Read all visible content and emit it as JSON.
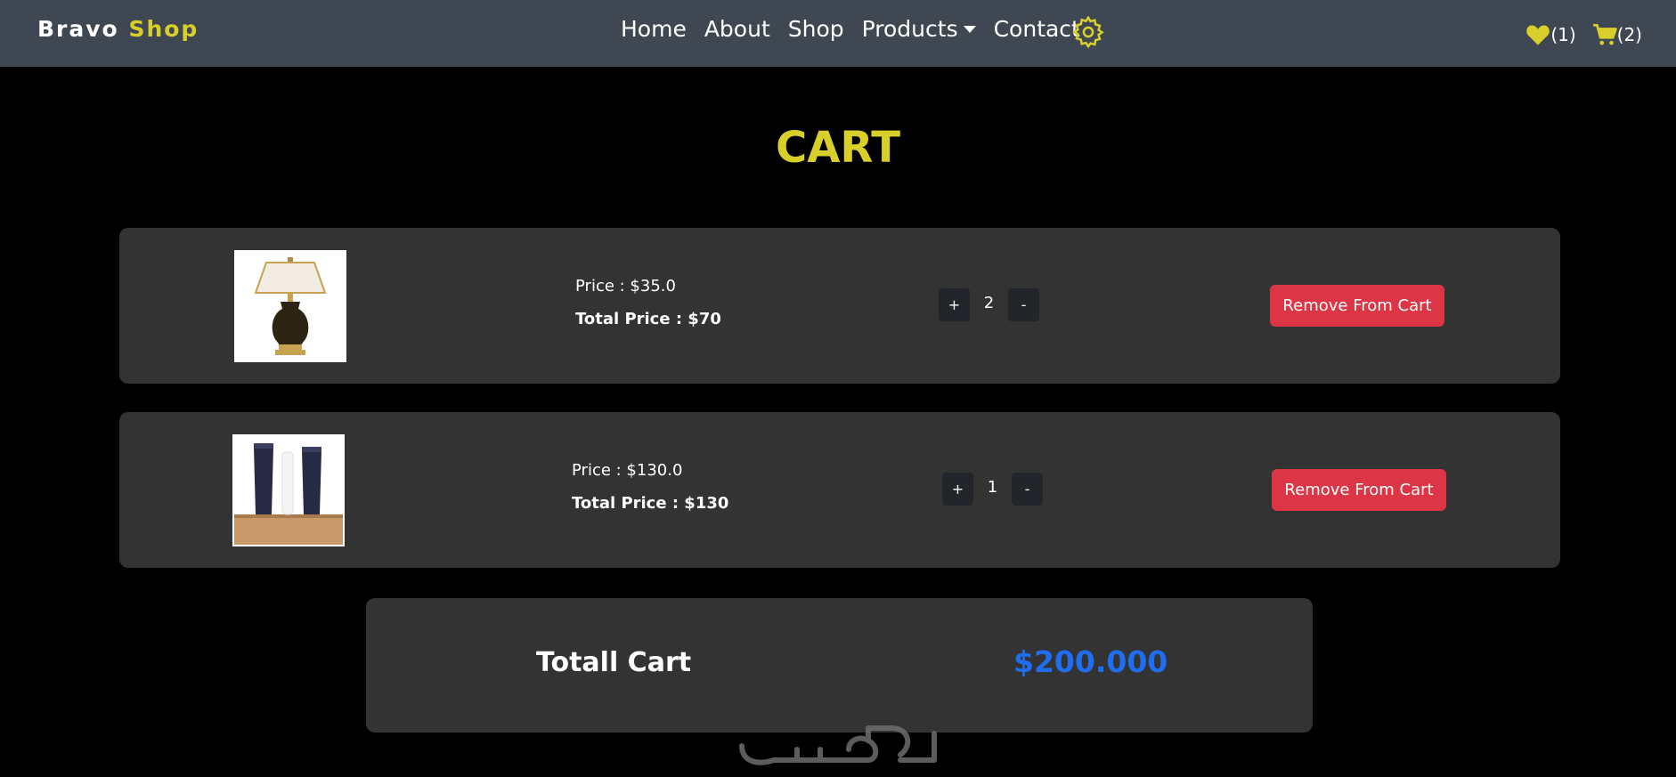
{
  "brand": {
    "part1": "Bravo",
    "part2": "Shop"
  },
  "nav": {
    "links": [
      "Home",
      "About",
      "Shop",
      "Products",
      "Contact"
    ],
    "settings_icon": "gear-icon"
  },
  "header_icons": {
    "wishlist_count": "(1)",
    "cart_count": "(2)"
  },
  "page": {
    "title": "CART"
  },
  "cart": {
    "items": [
      {
        "image": "table-lamp",
        "price": "Price : $35.0",
        "total": "Total Price : $70",
        "plus": "+",
        "quantity": "2",
        "minus": "-",
        "remove_label": "Remove From Cart"
      },
      {
        "image": "skincare-tubes",
        "price": "Price : $130.0",
        "total": "Total Price : $130",
        "plus": "+",
        "quantity": "1",
        "minus": "-",
        "remove_label": "Remove From Cart"
      }
    ],
    "total_label": "Totall Cart",
    "total_value": "$200.000"
  },
  "colors": {
    "navbar_bg": "#3f4852",
    "accent_yellow": "#d8cf2a",
    "danger": "#dc3545",
    "total_blue": "#1f6ef2",
    "card_bg": "#333333"
  }
}
